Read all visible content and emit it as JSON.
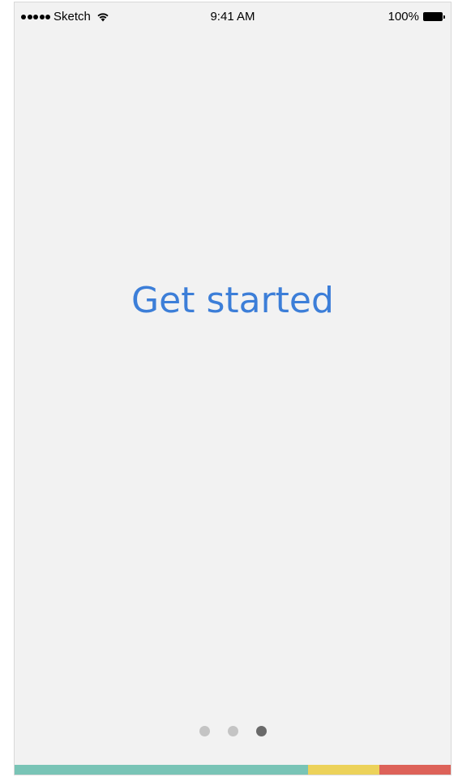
{
  "status_bar": {
    "carrier": "Sketch",
    "time": "9:41 AM",
    "battery": "100%",
    "icons": [
      "signal-dots-icon",
      "wifi-icon",
      "battery-icon"
    ]
  },
  "main": {
    "headline": "Get started"
  },
  "page_indicator": {
    "total_pages": 3,
    "active_page": 3
  },
  "color_bar": {
    "colors": [
      "#79c4b6",
      "#ecd25a",
      "#dd6259"
    ]
  },
  "colors": {
    "accent": "#3c7ed8",
    "background": "#f2f2f2"
  }
}
